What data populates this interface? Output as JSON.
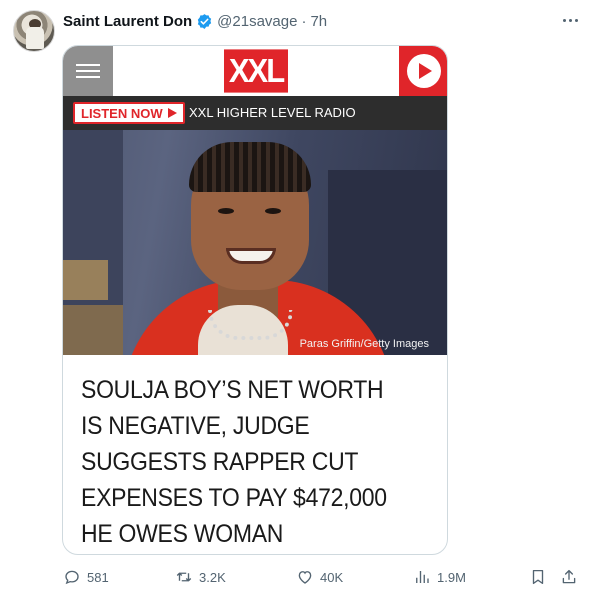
{
  "tweet": {
    "author_name": "Saint Laurent Don",
    "handle": "@21savage",
    "separator": "·",
    "time": "7h"
  },
  "card": {
    "logo_text": "XXL",
    "listen_label": "LISTEN NOW",
    "radio_label": "XXL HIGHER LEVEL RADIO",
    "photo_caption": "Paras Griffin/Getty Images",
    "headline_lines": [
      "SOULJA BOY’S NET WORTH",
      "IS NEGATIVE, JUDGE",
      "SUGGESTS RAPPER CUT",
      "EXPENSES TO PAY $472,000",
      "HE OWES WOMAN"
    ]
  },
  "actions": {
    "replies": "581",
    "retweets": "3.2K",
    "likes": "40K",
    "views": "1.9M"
  },
  "icons": {
    "avatar": "avatar",
    "verified": "verified-badge-icon",
    "more": "more-icon",
    "menu": "hamburger-menu-icon",
    "play": "play-icon",
    "reply": "reply-icon",
    "retweet": "retweet-icon",
    "like": "heart-icon",
    "views": "views-chart-icon",
    "bookmark": "bookmark-icon",
    "share": "share-icon"
  },
  "colors": {
    "accent": "#1d9bf0",
    "brand_red": "#e0252a",
    "muted": "#536471"
  }
}
